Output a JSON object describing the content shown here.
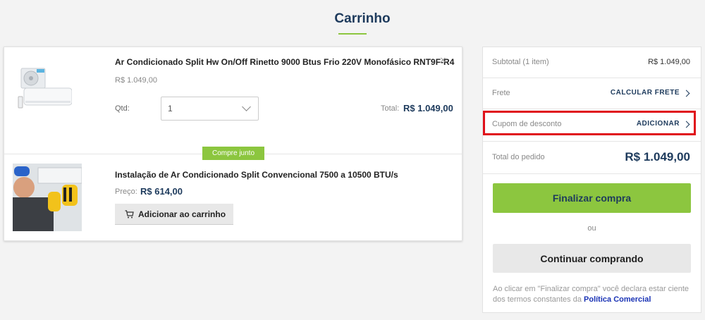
{
  "page": {
    "title": "Carrinho"
  },
  "cart": {
    "product": {
      "name": "Ar Condicionado Split Hw On/Off Rinetto 9000 Btus Frio 220V Monofásico RNT9F-R4",
      "unit_price": "R$ 1.049,00",
      "qty_label": "Qtd:",
      "qty_value": "1",
      "total_label": "Total:",
      "total_value": "R$ 1.049,00",
      "remove_icon": "×"
    },
    "badge": "Compre junto",
    "service": {
      "name": "Instalação de Ar Condicionado Split Convencional 7500 a 10500 BTU/s",
      "price_label": "Preço:",
      "price_value": "R$ 614,00",
      "add_button": "Adicionar ao carrinho"
    }
  },
  "summary": {
    "subtotal_label": "Subtotal (1 item)",
    "subtotal_value": "R$ 1.049,00",
    "frete_label": "Frete",
    "frete_link": "CALCULAR FRETE",
    "cupom_label": "Cupom de desconto",
    "cupom_link": "ADICIONAR",
    "total_label": "Total do pedido",
    "total_value": "R$ 1.049,00",
    "finalize_button": "Finalizar compra",
    "or_text": "ou",
    "continue_button": "Continuar comprando",
    "disclaimer_text": "Ao clicar em \"Finalizar compra\" você declara estar ciente dos termos constantes da ",
    "disclaimer_link": "Política Comercial"
  },
  "colors": {
    "brand_navy": "#1d3a5c",
    "brand_green": "#8cc63f",
    "highlight_red": "#e0101a"
  }
}
